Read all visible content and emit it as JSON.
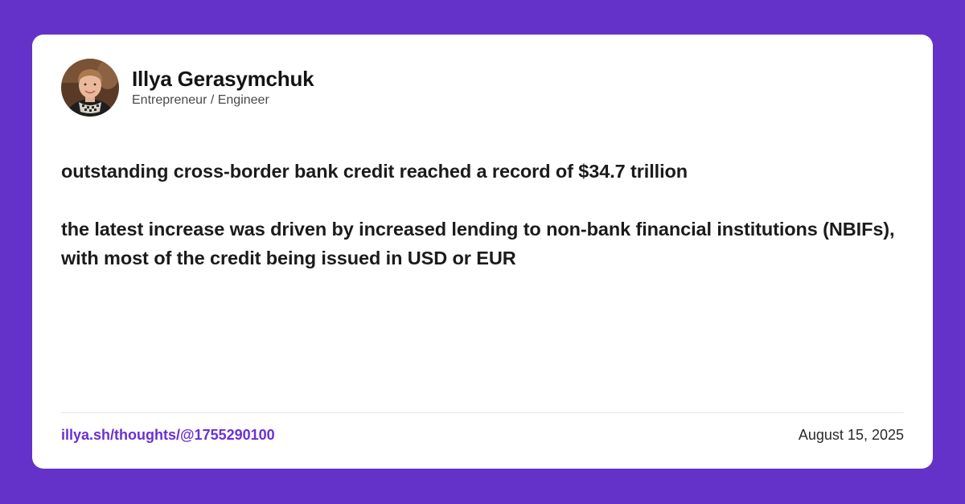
{
  "author": {
    "name": "Illya Gerasymchuk",
    "role": "Entrepreneur / Engineer",
    "avatar_icon": "profile-photo"
  },
  "post": {
    "paragraphs": [
      "outstanding cross-border bank credit reached a record of $34.7 trillion",
      "the latest increase was driven by increased lending to non-bank financial institutions (NBIFs), with most of the credit being issued in USD or EUR"
    ]
  },
  "footer": {
    "link": "illya.sh/thoughts/@1755290100",
    "date": "August 15, 2025"
  },
  "colors": {
    "background": "#6532c9",
    "card": "#ffffff",
    "link": "#6a30d6"
  }
}
